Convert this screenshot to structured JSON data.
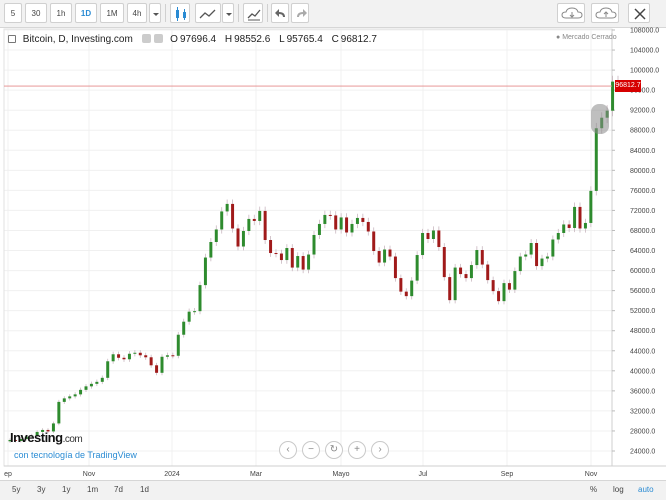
{
  "toolbar": {
    "intervals": [
      "5",
      "30",
      "1h",
      "1D",
      "1M",
      "4h"
    ],
    "active_interval": "1D"
  },
  "legend": {
    "symbol": "Bitcoin, D, Investing.com",
    "open_label": "O",
    "open": "97696.4",
    "high_label": "H",
    "high": "98552.6",
    "low_label": "L",
    "low": "95765.4",
    "close_label": "C",
    "close": "96812.7"
  },
  "market_status": "Mercado Cerrado",
  "last_price_tag": "96812.7",
  "branding": {
    "logo_main": "Investing",
    "logo_suffix": ".com",
    "powered_by": "con tecnología de TradingView"
  },
  "zoom_controls": [
    "‹",
    "−",
    "↻",
    "+",
    "›"
  ],
  "range_buttons": [
    "5y",
    "3y",
    "1y",
    "1m",
    "7d",
    "1d"
  ],
  "scale_buttons": [
    "%",
    "log",
    "auto"
  ],
  "colors": {
    "up": "#2e8b2e",
    "down": "#a01a1a",
    "price_line": "#e58a8a",
    "price_tag": "#d60000",
    "accent": "#2a8bd3"
  },
  "chart_data": {
    "type": "candlestick",
    "title": "Bitcoin, D, Investing.com",
    "x_tick_labels": [
      "ep",
      "Nov",
      "2024",
      "Mar",
      "Mayo",
      "Jul",
      "Sep",
      "Nov"
    ],
    "y_tick_labels": [
      "24000.0",
      "28000.0",
      "32000.0",
      "36000.0",
      "40000.0",
      "44000.0",
      "48000.0",
      "52000.0",
      "56000.0",
      "60000.0",
      "64000.0",
      "68000.0",
      "72000.0",
      "76000.0",
      "80000.0",
      "84000.0",
      "88000.0",
      "92000.0",
      "96000.0",
      "100000.0",
      "104000.0",
      "108000.0"
    ],
    "ylim": [
      22000,
      109000
    ],
    "last_close": 96812.7,
    "grid": true,
    "closes": [
      26200,
      26000,
      26400,
      26900,
      27100,
      27800,
      28200,
      27900,
      29500,
      33800,
      34500,
      34900,
      35300,
      36200,
      36900,
      37400,
      37800,
      38600,
      41900,
      43300,
      42600,
      42300,
      43400,
      43600,
      43100,
      42700,
      41100,
      39600,
      42800,
      43100,
      43000,
      47200,
      49800,
      51800,
      51900,
      57100,
      62600,
      65700,
      68200,
      71800,
      73300,
      68400,
      64800,
      67900,
      70300,
      69900,
      71900,
      66100,
      63500,
      63400,
      62100,
      64500,
      60600,
      62900,
      60200,
      63200,
      67100,
      69300,
      71100,
      71000,
      68200,
      70600,
      67600,
      69300,
      70500,
      69700,
      67800,
      63900,
      61600,
      64200,
      62800,
      58500,
      55800,
      54900,
      58000,
      63100,
      67500,
      66300,
      68000,
      64700,
      58700,
      54100,
      60600,
      59300,
      58500,
      61100,
      64100,
      61200,
      58100,
      55900,
      53900,
      57500,
      56200,
      59900,
      62800,
      63200,
      65500,
      60900,
      62400,
      62800,
      66200,
      67500,
      69200,
      68500,
      72700,
      68400,
      69500,
      75900,
      88400,
      90500,
      91900,
      97700,
      96800
    ]
  }
}
